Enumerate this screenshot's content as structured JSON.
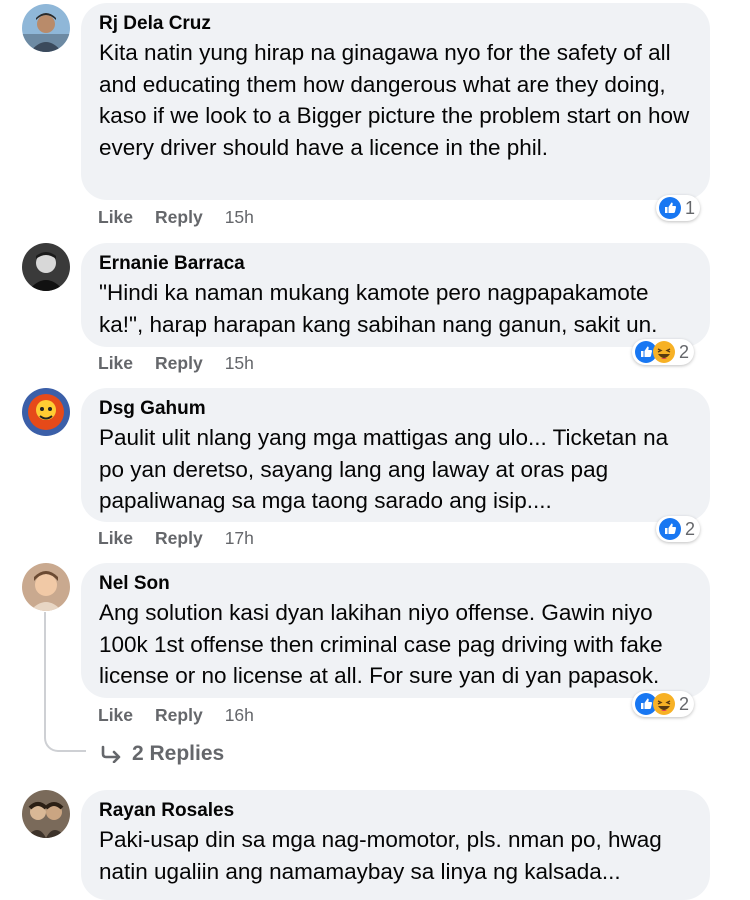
{
  "comments": [
    {
      "author": "Rj Dela Cruz",
      "text": "Kita natin yung hirap na ginagawa nyo for the safety of all and educating them how dangerous what are they doing, kaso if we look to a Bigger picture the problem start on how every driver should have a licence in the phil.",
      "like_label": "Like",
      "reply_label": "Reply",
      "time": "15h",
      "reactions": [
        "like"
      ],
      "reaction_count": "1"
    },
    {
      "author": "Ernanie Barraca",
      "text": "\"Hindi ka naman mukang kamote pero nagpapakamote ka!\", harap harapan kang sabihan nang ganun, sakit un.",
      "like_label": "Like",
      "reply_label": "Reply",
      "time": "15h",
      "reactions": [
        "like",
        "haha"
      ],
      "reaction_count": "2"
    },
    {
      "author": "Dsg Gahum",
      "text": "Paulit ulit nlang yang mga mattigas ang ulo... Ticketan na po yan deretso, sayang lang ang laway at oras pag papaliwanag sa mga taong sarado ang isip....",
      "like_label": "Like",
      "reply_label": "Reply",
      "time": "17h",
      "reactions": [
        "like"
      ],
      "reaction_count": "2"
    },
    {
      "author": "Nel Son",
      "text": "Ang solution kasi dyan lakihan niyo offense. Gawin niyo 100k 1st offense then criminal case pag driving with fake license or no license at all. For sure yan di yan papasok.",
      "like_label": "Like",
      "reply_label": "Reply",
      "time": "16h",
      "reactions": [
        "like",
        "haha"
      ],
      "reaction_count": "2"
    },
    {
      "author": "Rayan Rosales",
      "text": "Paki-usap din sa mga nag-momotor, pls. nman po, hwag natin ugaliin ang namamaybay sa linya ng kalsada..."
    }
  ],
  "replies_link": {
    "label": "2 Replies",
    "icon": "reply-arrow-icon"
  },
  "colors": {
    "bubble": "#f0f2f5",
    "like_blue": "#1877f2",
    "haha_yellow": "#f7b125",
    "meta_gray": "#65676b"
  }
}
